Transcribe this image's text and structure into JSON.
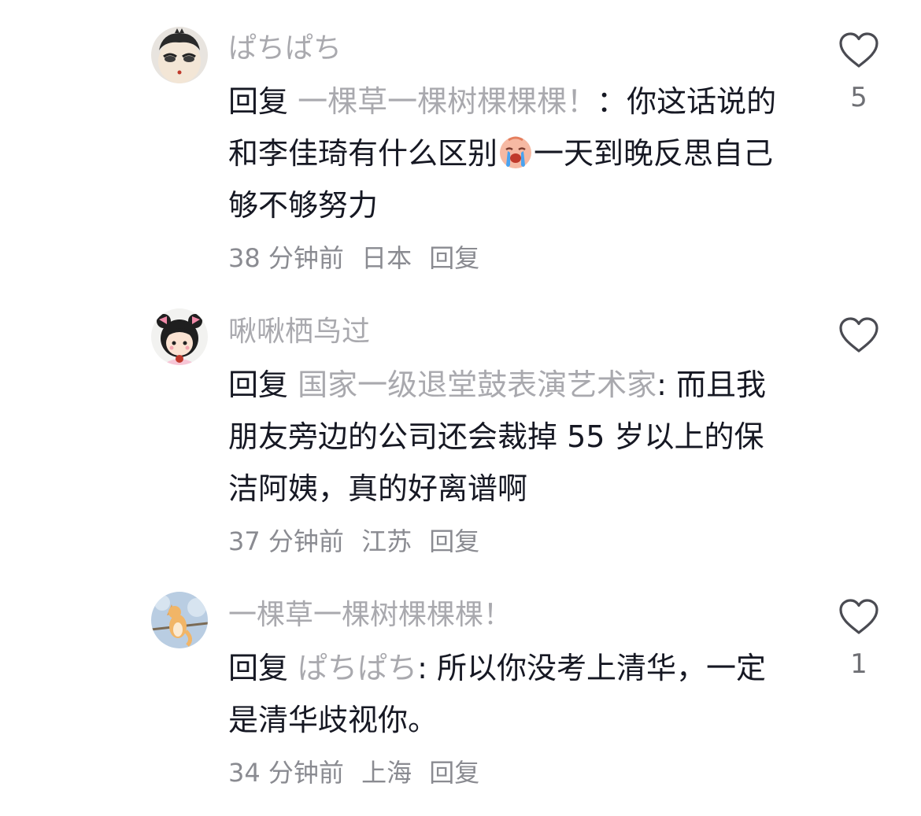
{
  "comments": [
    {
      "username": "ぱちぱち",
      "reply_word": "回复",
      "reply_target": "一棵草一棵树棵棵棵！",
      "text_before_emoji": "：你这话说的和李佳琦有什么区别",
      "emoji": "crying-face-emoji",
      "text_after_emoji": "一天到晚反思自己够不够努力",
      "time": "38 分钟前",
      "location": "日本",
      "reply_action": "回复",
      "likes": "5"
    },
    {
      "username": "啾啾栖鸟过",
      "reply_word": "回复",
      "reply_target": "国家一级退堂鼓表演艺术家",
      "text": ": 而且我朋友旁边的公司还会裁掉 55 岁以上的保洁阿姨，真的好离谱啊",
      "time": "37 分钟前",
      "location": "江苏",
      "reply_action": "回复",
      "likes": ""
    },
    {
      "username": "一棵草一棵树棵棵棵！",
      "reply_word": "回复",
      "reply_target": "ぱちぱち",
      "text": ": 所以你没考上清华，一定是清华歧视你。",
      "time": "34 分钟前",
      "location": "上海",
      "reply_action": "回复",
      "likes": "1"
    }
  ],
  "icons": {
    "like": "heart-outline-icon"
  },
  "colors": {
    "username": "#a9a9ae",
    "body": "#161823",
    "meta": "#8a8b91",
    "like_count": "#6f7075"
  }
}
